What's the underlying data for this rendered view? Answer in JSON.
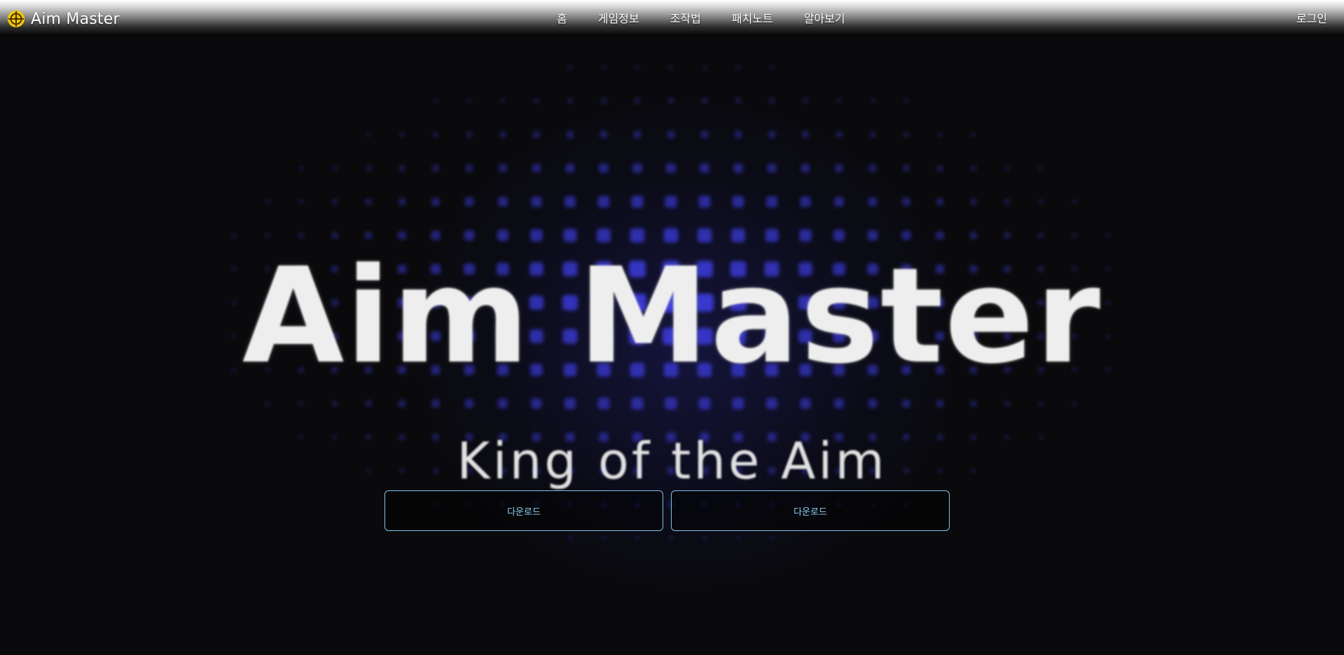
{
  "brand": {
    "name": "Aim Master",
    "icon": "crosshair-icon",
    "icon_color": "#f5c400"
  },
  "nav": {
    "items": [
      {
        "label": "홈"
      },
      {
        "label": "게임정보"
      },
      {
        "label": "조작법"
      },
      {
        "label": "패치노트"
      },
      {
        "label": "알아보기"
      }
    ],
    "login_label": "로그인"
  },
  "hero": {
    "title": "Aim Master",
    "subtitle": "King of the Aim",
    "background_dot_color": "#3a3ad8",
    "buttons": [
      {
        "label": "다운로드"
      },
      {
        "label": "다운로드"
      }
    ],
    "button_accent": "#7fc3e6"
  }
}
